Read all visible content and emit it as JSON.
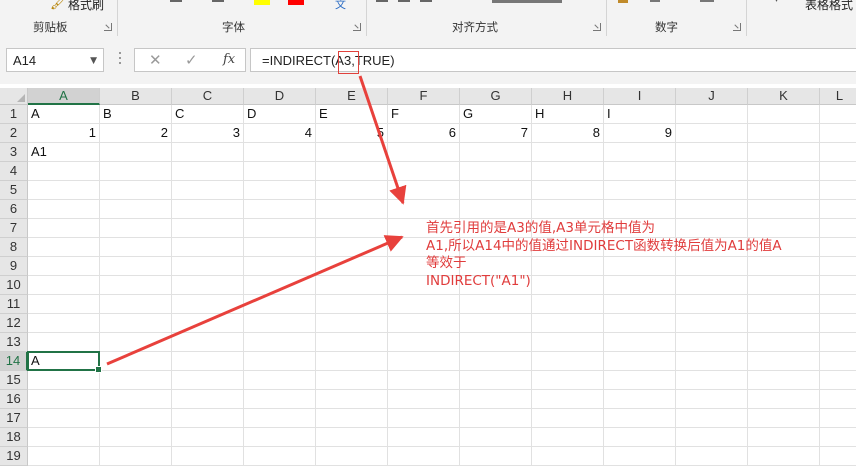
{
  "ribbon": {
    "format_painter": "格式刷",
    "groups": {
      "clipboard": "剪贴板",
      "font": "字体",
      "alignment": "对齐方式",
      "number": "数字",
      "table_format": "表格格式"
    },
    "font_color_hex": "#ff0000",
    "highlight_color_hex": "#ffff00"
  },
  "formula_bar": {
    "name_box": "A14",
    "formula": "=INDIRECT(A3,TRUE)",
    "cancel": "✕",
    "enter": "✓",
    "fx": "fx"
  },
  "sheet": {
    "columns": [
      "A",
      "B",
      "C",
      "D",
      "E",
      "F",
      "G",
      "H",
      "I",
      "J",
      "K",
      "L"
    ],
    "rows": [
      "1",
      "2",
      "3",
      "4",
      "5",
      "6",
      "7",
      "8",
      "9",
      "10",
      "11",
      "12",
      "13",
      "14",
      "15",
      "16",
      "17",
      "18",
      "19"
    ],
    "row1": [
      "A",
      "B",
      "C",
      "D",
      "E",
      "F",
      "G",
      "H",
      "I"
    ],
    "row2": [
      "1",
      "2",
      "3",
      "4",
      "5",
      "6",
      "7",
      "8",
      "9"
    ],
    "a3": "A1",
    "a14": "A",
    "selected_cell": "A14",
    "accent_hex": "#217346"
  },
  "annotation": {
    "line1": "首先引用的是A3的值,A3单元格中值为",
    "line2": "A1,所以A14中的值通过INDIRECT函数转换后值为A1的值A",
    "line3": "等效于",
    "line4": "INDIRECT(\"A1\")",
    "color_hex": "#e03c3c"
  }
}
